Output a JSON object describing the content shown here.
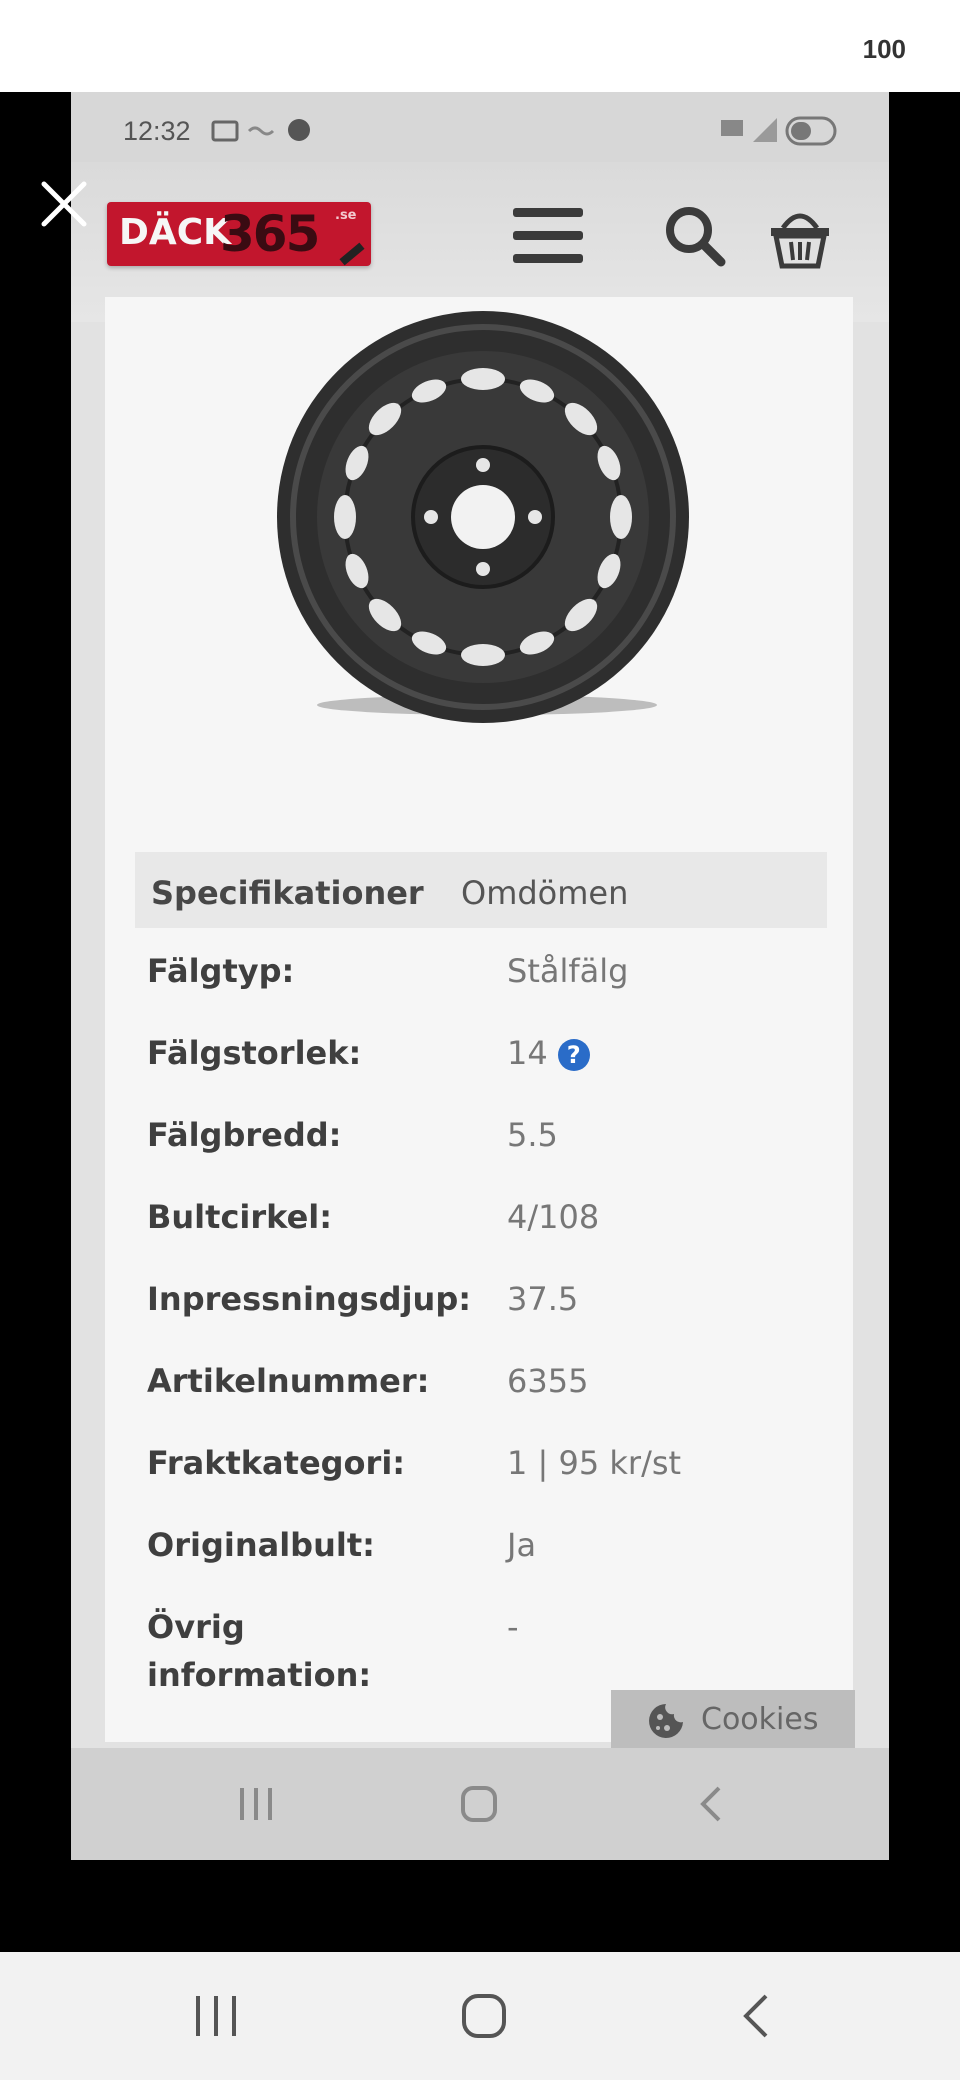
{
  "viewer": {
    "counter": "100",
    "close_icon": "close-icon"
  },
  "status_bar": {
    "time": "12:32"
  },
  "site": {
    "logo_text_a": "DÄCK",
    "logo_text_b": "365",
    "logo_text_c": ".se",
    "colors": {
      "logo_red": "#c2162d",
      "help_blue": "#2a6cc8"
    }
  },
  "tabs": [
    {
      "label": "Specifikationer",
      "active": true
    },
    {
      "label": "Omdömen",
      "active": false
    }
  ],
  "specs": [
    {
      "label": "Fälgtyp:",
      "value": "Stålfälg"
    },
    {
      "label": "Fälgstorlek:",
      "value": "14"
    },
    {
      "label": "Fälgbredd:",
      "value": "5.5"
    },
    {
      "label": "Bultcirkel:",
      "value": "4/108"
    },
    {
      "label": "Inpressningsdjup:",
      "value": "37.5"
    },
    {
      "label": "Artikelnummer:",
      "value": "6355"
    },
    {
      "label": "Fraktkategori:",
      "value": "1 | 95 kr/st"
    },
    {
      "label": "Originalbult:",
      "value": "Ja"
    },
    {
      "label": "Övrig information:",
      "value": "-"
    }
  ],
  "help_icon_glyph": "?",
  "cookies_label": "Cookies"
}
